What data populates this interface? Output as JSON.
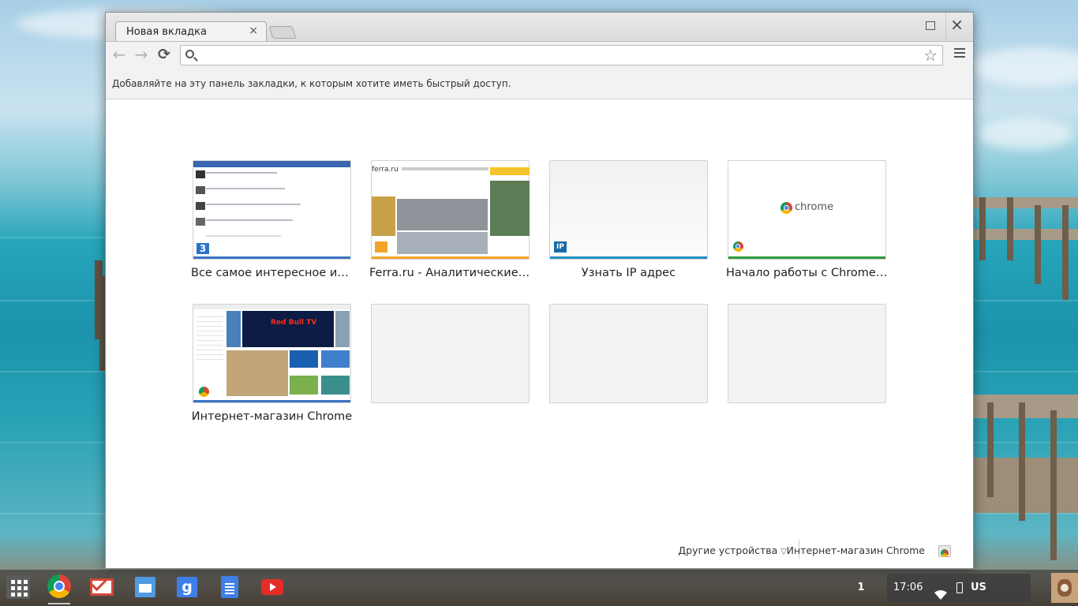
{
  "tab": {
    "title": "Новая вкладка",
    "close": "×"
  },
  "window": {
    "close": "×"
  },
  "omnibox": {
    "value": "",
    "placeholder": ""
  },
  "bookmarks": {
    "message": "Добавляйте на эту панель закладки, к которым хотите иметь быстрый доступ."
  },
  "tiles": [
    {
      "label": "Все самое интересное из м...",
      "bar_color": "#3b74c4"
    },
    {
      "label": "Ferra.ru - Аналитические о...",
      "bar_color": "#f2a52a",
      "thumb_logo": "ferra.ru"
    },
    {
      "label": "Узнать IP адрес",
      "bar_color": "#1f8fc4",
      "favicon": "IP"
    },
    {
      "label": "Начало работы с Chrome OS",
      "bar_color": "#2e9a3c",
      "thumb_logo": "chrome"
    },
    {
      "label": "Интернет-магазин Chrome",
      "bar_color": "#3b74c4",
      "thumb_text": "Red Bull TV"
    },
    {
      "label": ""
    },
    {
      "label": ""
    },
    {
      "label": ""
    }
  ],
  "footer": {
    "devices": "Другие устройства",
    "store": "Интернет-магазин Chrome"
  },
  "shelf": {
    "apps": [
      "chrome-icon",
      "gmail-icon",
      "files-icon",
      "google-search-icon",
      "docs-icon",
      "youtube-icon"
    ],
    "tray": {
      "notifications": "1",
      "time": "17:06",
      "input_method": "US"
    }
  }
}
